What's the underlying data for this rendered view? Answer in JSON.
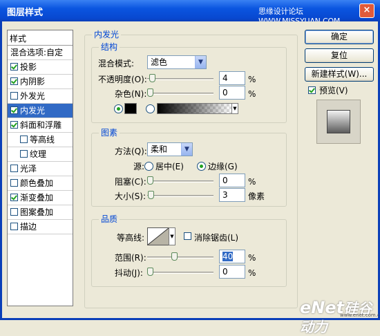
{
  "window": {
    "title": "图层样式",
    "watermark": "思缘设计论坛 WWW.MISSYUAN.COM",
    "close": "×"
  },
  "left_panel": {
    "header": "样式",
    "items": [
      {
        "label": "混合选项:自定",
        "checkbox": false,
        "checked": false,
        "indent": false,
        "selected": false
      },
      {
        "label": "投影",
        "checkbox": true,
        "checked": true,
        "indent": false,
        "selected": false
      },
      {
        "label": "内阴影",
        "checkbox": true,
        "checked": true,
        "indent": false,
        "selected": false
      },
      {
        "label": "外发光",
        "checkbox": true,
        "checked": false,
        "indent": false,
        "selected": false
      },
      {
        "label": "内发光",
        "checkbox": true,
        "checked": true,
        "indent": false,
        "selected": true
      },
      {
        "label": "斜面和浮雕",
        "checkbox": true,
        "checked": true,
        "indent": false,
        "selected": false
      },
      {
        "label": "等高线",
        "checkbox": true,
        "checked": false,
        "indent": true,
        "selected": false
      },
      {
        "label": "纹理",
        "checkbox": true,
        "checked": false,
        "indent": true,
        "selected": false
      },
      {
        "label": "光泽",
        "checkbox": true,
        "checked": false,
        "indent": false,
        "selected": false
      },
      {
        "label": "颜色叠加",
        "checkbox": true,
        "checked": false,
        "indent": false,
        "selected": false
      },
      {
        "label": "渐变叠加",
        "checkbox": true,
        "checked": true,
        "indent": false,
        "selected": false
      },
      {
        "label": "图案叠加",
        "checkbox": true,
        "checked": false,
        "indent": false,
        "selected": false
      },
      {
        "label": "描边",
        "checkbox": true,
        "checked": false,
        "indent": false,
        "selected": false
      }
    ]
  },
  "inner_glow": {
    "title": "内发光",
    "structure": {
      "title": "结构",
      "blend_mode_label": "混合模式:",
      "blend_mode_value": "滤色",
      "opacity_label": "不透明度(O):",
      "opacity_value": "4",
      "opacity_unit": "%",
      "opacity_level": 0.04,
      "noise_label": "杂色(N):",
      "noise_value": "0",
      "noise_unit": "%",
      "noise_level": 0,
      "color_mode": "solid",
      "color": "#000000"
    },
    "elements": {
      "title": "图素",
      "technique_label": "方法(Q):",
      "technique_value": "柔和",
      "source_label": "源:",
      "source_center": "居中(E)",
      "source_edge": "边缘(G)",
      "source_selected": "edge",
      "choke_label": "阻塞(C):",
      "choke_value": "0",
      "choke_unit": "%",
      "choke_level": 0,
      "size_label": "大小(S):",
      "size_value": "3",
      "size_unit": "像素",
      "size_level": 0.012
    },
    "quality": {
      "title": "品质",
      "contour_label": "等高线:",
      "anti_alias_label": "消除锯齿(L)",
      "anti_alias_checked": false,
      "range_label": "范围(R):",
      "range_value": "40",
      "range_unit": "%",
      "range_level": 0.4,
      "jitter_label": "抖动(J):",
      "jitter_value": "0",
      "jitter_unit": "%",
      "jitter_level": 0
    }
  },
  "buttons": {
    "ok": "确定",
    "reset": "复位",
    "new_style": "新建样式(W)...",
    "preview_label": "预览(V)",
    "preview_checked": true
  },
  "logo": {
    "text": "eNet",
    "sub": "硅谷动力",
    "url": "www.enet.com.cn"
  }
}
